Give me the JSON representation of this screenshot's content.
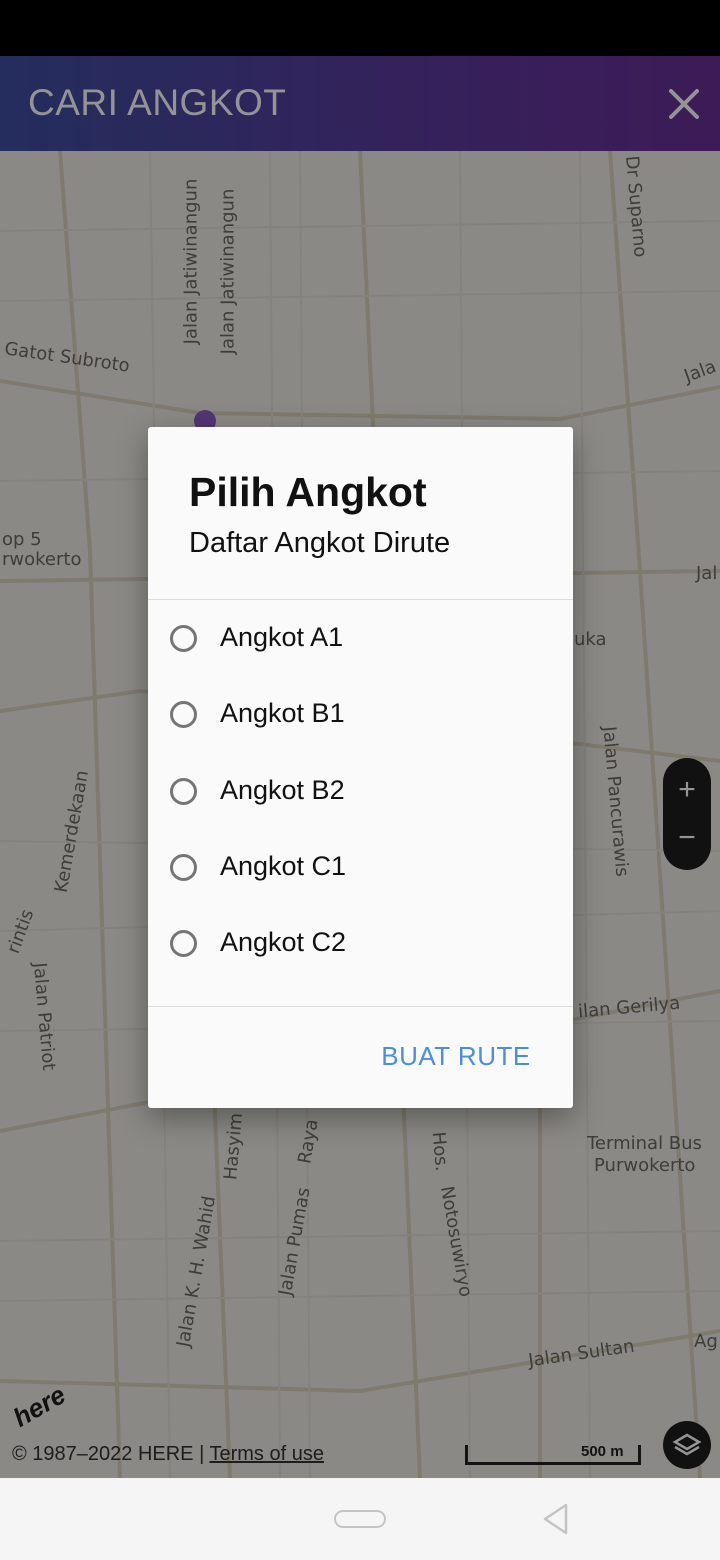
{
  "app_bar": {
    "title": "CARI ANGKOT",
    "close_icon": "close-icon",
    "gradient_start": "#3e4fa0",
    "gradient_end": "#6a2f95"
  },
  "map": {
    "street_labels": [
      "Gatot Subroto",
      "Jalan Jatiwinangun",
      "Jalan Jatiwinangun",
      "Dr Suparno",
      "Jala",
      "op 5",
      "rwokerto",
      "Jal",
      "uka",
      "Jalan Pancurawis",
      "Kemerdekaan",
      "rintis",
      "Jalan Patriot",
      "ilan Gerilya",
      "Terminal Bus",
      "Purwokerto",
      "Hasyim",
      "Jalan K. H. Wahid",
      "Raya",
      "Jalan Pumas",
      "Hos.",
      "Notosuwiryo",
      "Jalan Sultan",
      "Ag"
    ],
    "zoom_in_label": "+",
    "zoom_out_label": "−",
    "copyright_text": "© 1987–2022 HERE |",
    "terms_label": "Terms of use",
    "logo_text": "here",
    "scale_label": "500 m",
    "layers_icon": "layers-icon"
  },
  "dialog": {
    "title": "Pilih Angkot",
    "subtitle": "Daftar Angkot Dirute",
    "options": [
      {
        "label": "Angkot A1",
        "selected": false
      },
      {
        "label": "Angkot B1",
        "selected": false
      },
      {
        "label": "Angkot B2",
        "selected": false
      },
      {
        "label": "Angkot C1",
        "selected": false
      },
      {
        "label": "Angkot C2",
        "selected": false
      }
    ],
    "action_label": "BUAT RUTE",
    "accent_color": "#4a8ee3"
  },
  "nav_bar": {
    "home_icon": "home-pill-icon",
    "back_icon": "back-triangle-icon"
  }
}
